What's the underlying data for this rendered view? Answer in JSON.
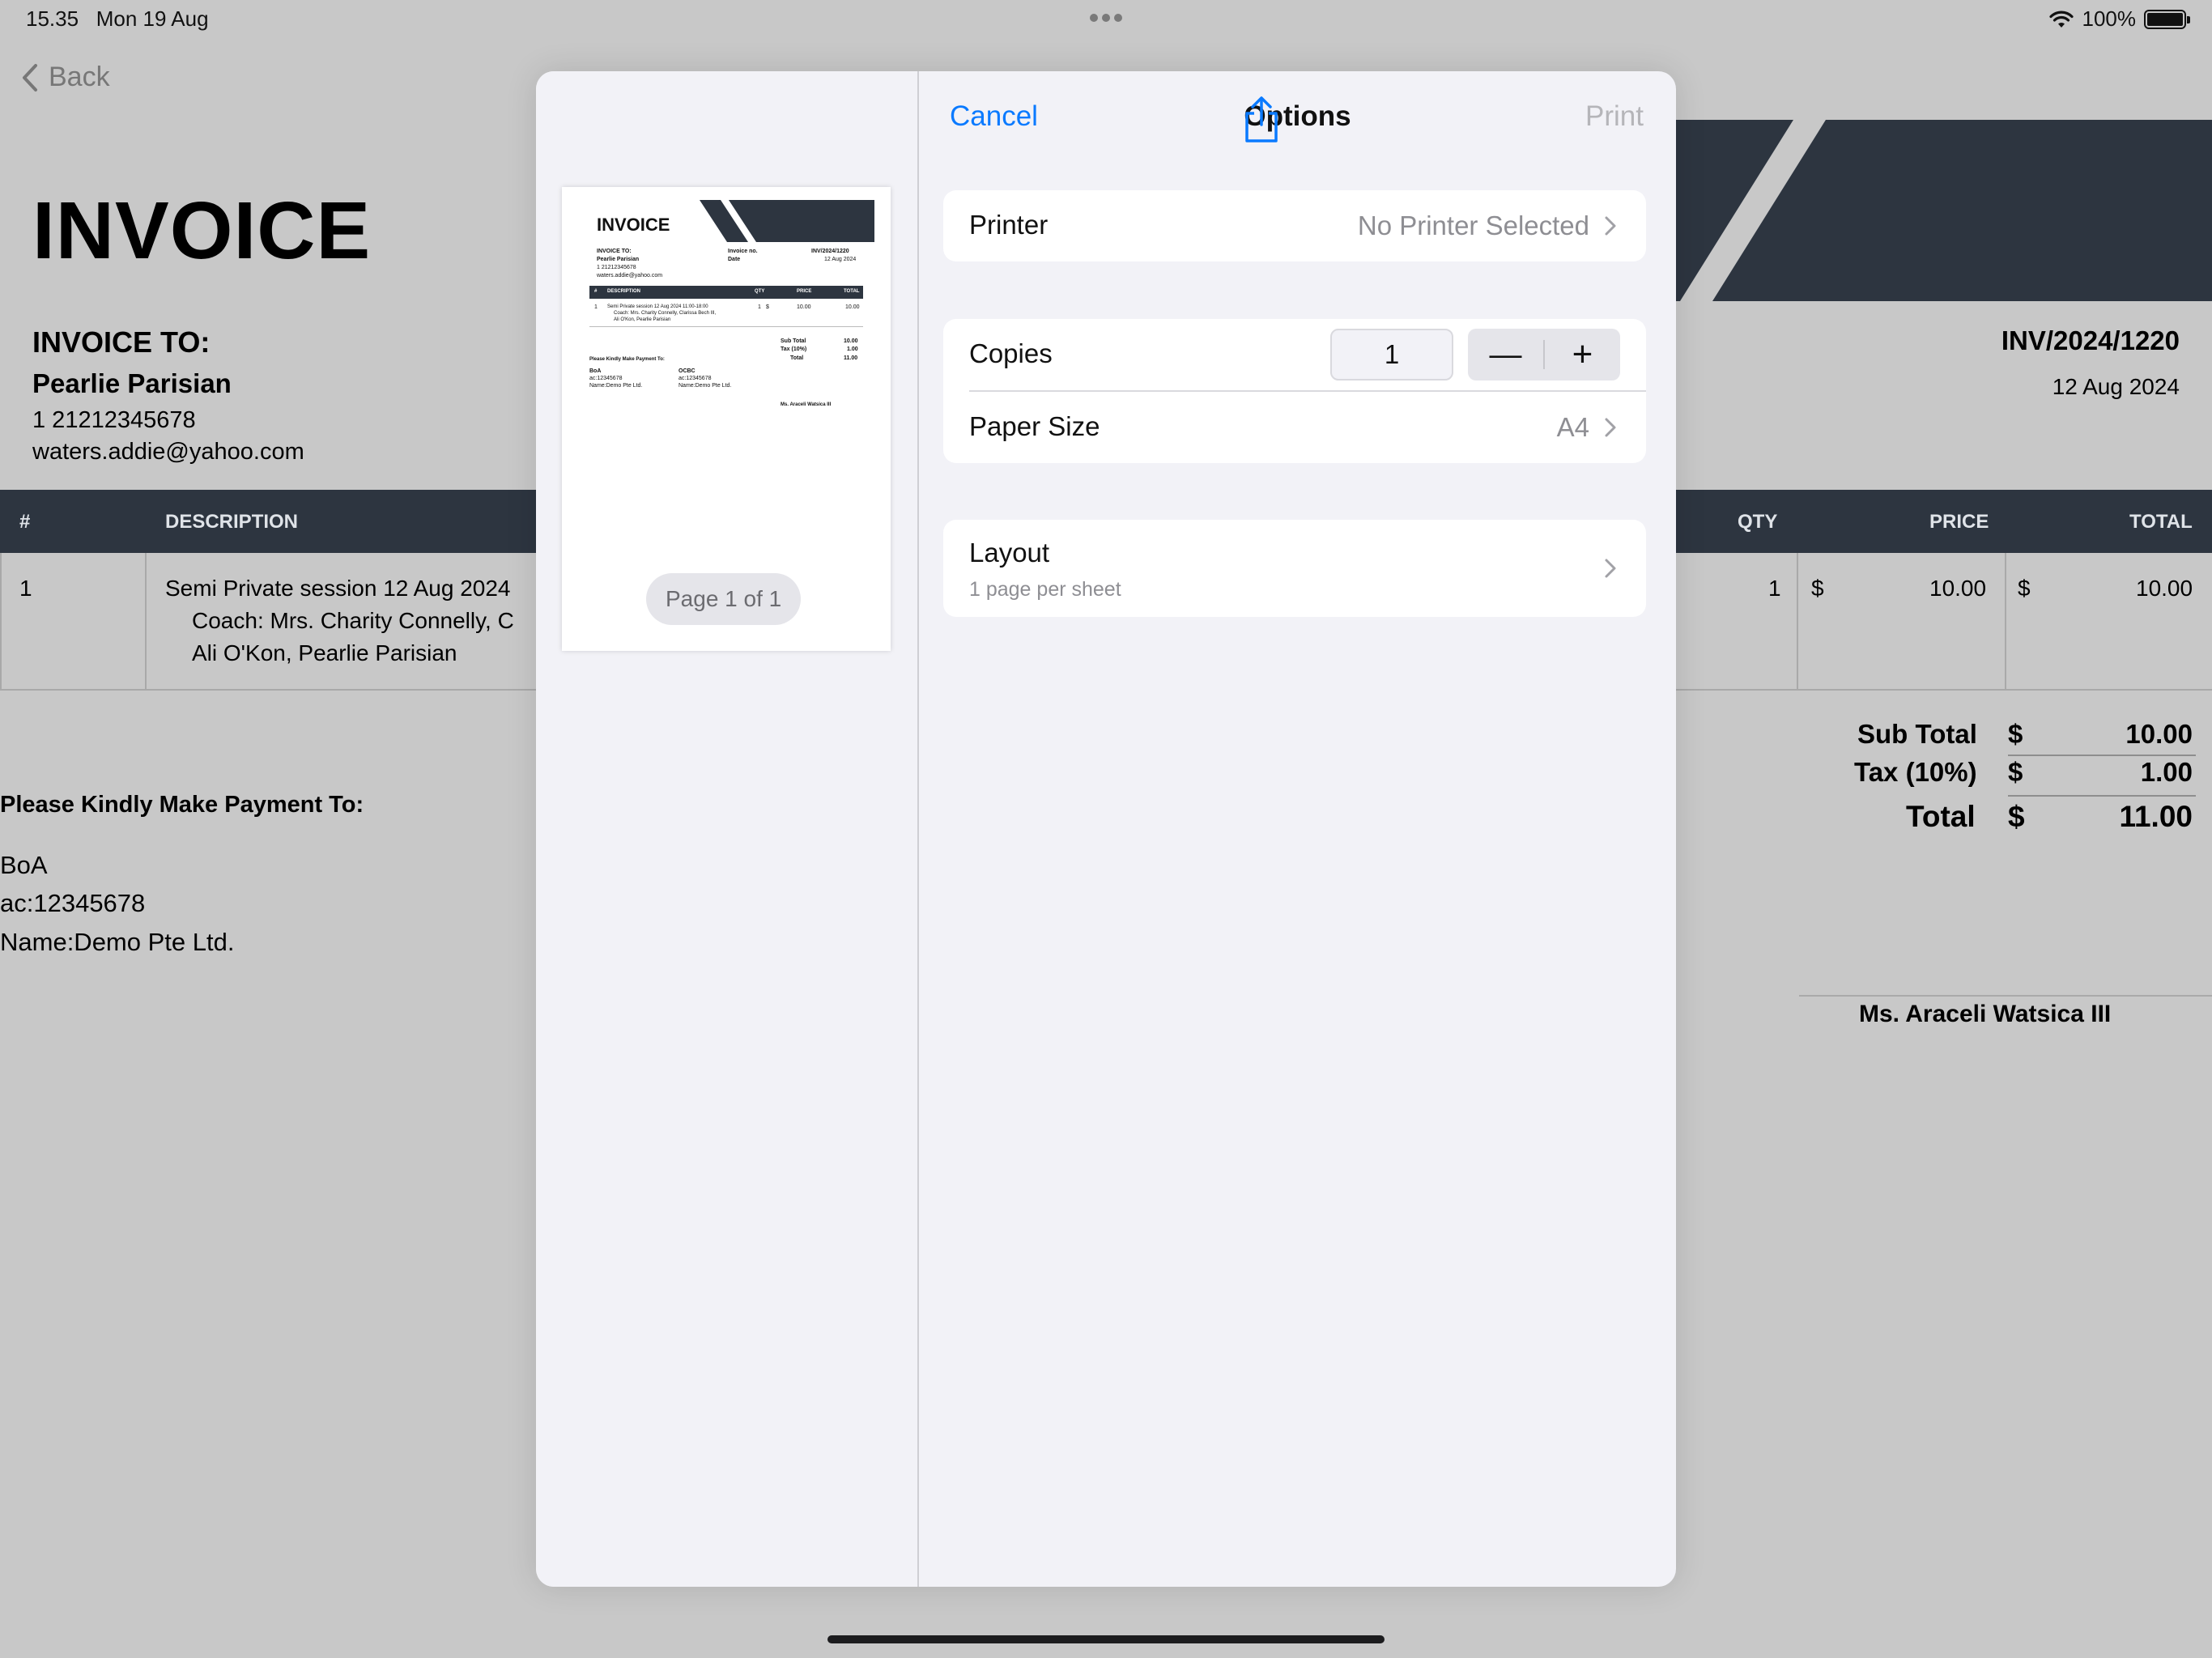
{
  "status_bar": {
    "time": "15.35",
    "date": "Mon 19 Aug",
    "battery": "100%"
  },
  "nav": {
    "back_label": "Back"
  },
  "invoice": {
    "title": "INVOICE",
    "to_label": "INVOICE TO:",
    "to_name": "Pearlie Parisian",
    "to_phone": "1 21212345678",
    "to_email": "waters.addie@yahoo.com",
    "number": "INV/2024/1220",
    "date": "12 Aug 2024",
    "table": {
      "headers": {
        "num": "#",
        "description": "DESCRIPTION",
        "qty": "QTY",
        "price": "PRICE",
        "total": "TOTAL"
      },
      "rows": [
        {
          "num": "1",
          "desc_line1": "Semi Private session 12 Aug 2024",
          "desc_line2": "Coach: Mrs. Charity Connelly, C",
          "desc_line3": "Ali O'Kon, Pearlie Parisian",
          "qty": "1",
          "price_currency": "$",
          "price": "10.00",
          "total_currency": "$",
          "total": "10.00"
        }
      ]
    },
    "totals": {
      "subtotal_label": "Sub Total",
      "subtotal_currency": "$",
      "subtotal": "10.00",
      "tax_label": "Tax (10%)",
      "tax_currency": "$",
      "tax": "1.00",
      "total_label": "Total",
      "total_currency": "$",
      "total": "11.00"
    },
    "payment": {
      "label": "Please Kindly Make Payment To:",
      "bank": "BoA",
      "account": "ac:12345678",
      "name": "Name:Demo Pte Ltd."
    },
    "signatory": "Ms. Araceli Watsica III"
  },
  "thumbnail": {
    "title": "INVOICE",
    "to_label": "INVOICE TO:",
    "to_name": "Pearlie Parisian",
    "to_phone": "1 21212345678",
    "to_email": "waters.addie@yahoo.com",
    "inv_no_label": "Invoice no.",
    "inv_no": "INV/2024/1220",
    "date_label": "Date",
    "date": "12 Aug 2024",
    "head_num": "#",
    "head_desc": "DESCRIPTION",
    "head_qty": "QTY",
    "head_price": "PRICE",
    "head_total": "TOTAL",
    "row_desc1": "Semi Private session 12 Aug 2024 11:00-18:00",
    "row_desc2": "Coach: Mrs. Charity Connelly, Clarissa Bech III,",
    "row_desc3": "Ali O'Kon, Pearlie Parisian",
    "row_num": "1",
    "row_qty": "1",
    "row_cur": "$",
    "row_price": "10.00",
    "row_total": "10.00",
    "sub_label": "Sub Total",
    "sub_val": "10.00",
    "tax_label": "Tax (10%)",
    "tax_val": "1.00",
    "tot_label": "Total",
    "tot_val": "11.00",
    "pay_label": "Please Kindly Make Payment To:",
    "bank1": "BoA",
    "acc1": "ac:12345678",
    "name1": "Name:Demo Pte Ltd.",
    "bank2": "OCBC",
    "acc2": "ac:12345678",
    "name2": "Name:Demo Pte Ltd.",
    "signatory": "Ms. Araceli Watsica III"
  },
  "print_sheet": {
    "page_indicator": "Page 1 of 1",
    "cancel_label": "Cancel",
    "title": "Options",
    "print_label": "Print",
    "printer_label": "Printer",
    "printer_value": "No Printer Selected",
    "copies_label": "Copies",
    "copies_value": "1",
    "decrement_label": "—",
    "increment_label": "+",
    "paper_size_label": "Paper Size",
    "paper_size_value": "A4",
    "layout_label": "Layout",
    "layout_value": "1 page per sheet"
  },
  "colors": {
    "accent": "#0a7aff",
    "dark_header": "#2d3540",
    "sheet_bg": "#f2f2f7",
    "disabled": "#b5b5b9"
  },
  "icons": {
    "back": "chevron-left-icon",
    "share": "share-icon",
    "disclosure": "chevron-right-icon",
    "wifi": "wifi-icon",
    "battery": "battery-icon"
  }
}
